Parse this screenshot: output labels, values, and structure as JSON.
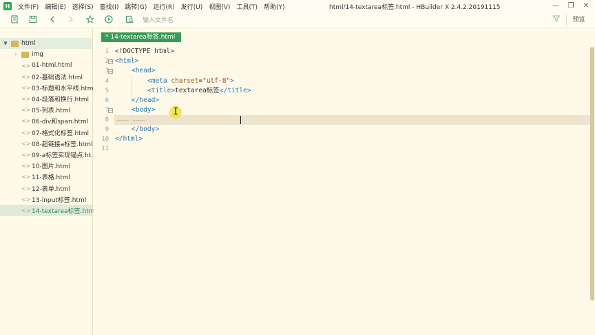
{
  "window": {
    "title": "html/14-textarea标签.html - HBuilder X 2.4.2.20191115",
    "logo": "H",
    "minimize": "—",
    "restore": "❐",
    "close": "✕"
  },
  "menu": [
    "文件(F)",
    "编辑(E)",
    "选择(S)",
    "查找(I)",
    "跳转(G)",
    "运行(R)",
    "发行(U)",
    "视图(V)",
    "工具(T)",
    "帮助(Y)"
  ],
  "toolbar": {
    "search_placeholder": "输入文件名",
    "preview_label": "预览"
  },
  "sidebar": {
    "project": "html",
    "items": [
      {
        "label": "img",
        "type": "folder"
      },
      {
        "label": "01-html.html",
        "type": "file"
      },
      {
        "label": "02-基础语法.html",
        "type": "file"
      },
      {
        "label": "03-标题和水平线.html",
        "type": "file"
      },
      {
        "label": "04-段落和换行.html",
        "type": "file"
      },
      {
        "label": "05-列表.html",
        "type": "file"
      },
      {
        "label": "06-div和span.html",
        "type": "file"
      },
      {
        "label": "07-格式化标签.html",
        "type": "file"
      },
      {
        "label": "08-超链接a标签.html",
        "type": "file"
      },
      {
        "label": "09-a标签实现锚点.ht...",
        "type": "file"
      },
      {
        "label": "10-图片.html",
        "type": "file"
      },
      {
        "label": "11-表格.html",
        "type": "file"
      },
      {
        "label": "12-表单.html",
        "type": "file"
      },
      {
        "label": "13-input标签.html",
        "type": "file"
      },
      {
        "label": "14-textarea标签.html",
        "type": "file",
        "active": true
      }
    ]
  },
  "editor": {
    "tab_label": "* 14-textarea标签.html",
    "line_numbers": [
      "1",
      "2",
      "3",
      "4",
      "5",
      "6",
      "7",
      "8",
      "9",
      "10",
      "11"
    ],
    "fold_marker": "−",
    "ibeam": "I",
    "code": {
      "l1": "<!DOCTYPE html>",
      "l2_tag": "<html>",
      "l3_tag": "<head>",
      "l4_open": "<meta ",
      "l4_attr": "charset",
      "l4_eq": "=",
      "l4_val": "\"utf-8\"",
      "l4_close": ">",
      "l5_open": "<title>",
      "l5_text": "textarea标签",
      "l5_close": "</title>",
      "l6_tag": "</head>",
      "l7_tag": "<body>",
      "l9_tag": "</body>",
      "l10_tag": "</html>"
    }
  },
  "icons": {
    "toolbar": [
      "new-file-icon",
      "save-icon",
      "back-icon",
      "forward-icon",
      "star-icon",
      "run-icon",
      "browser-preview-icon"
    ],
    "filter": "filter-icon",
    "accent": "#3b9a5a"
  }
}
